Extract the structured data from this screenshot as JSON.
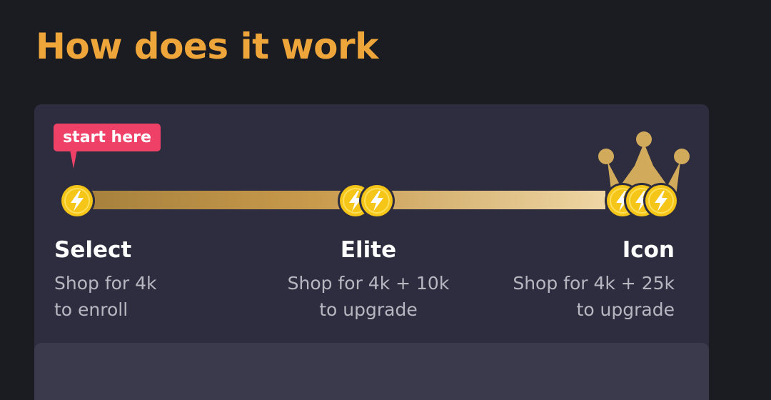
{
  "page": {
    "title": "How does it work",
    "title_color": "#eea53a"
  },
  "card": {
    "start_tag": "start here",
    "tiers": [
      {
        "name": "Select",
        "desc_line1": "Shop for 4k",
        "desc_line2": "to enroll",
        "coin_count": 1
      },
      {
        "name": "Elite",
        "desc_line1": "Shop for 4k + 10k",
        "desc_line2": "to upgrade",
        "coin_count": 2
      },
      {
        "name": "Icon",
        "desc_line1": "Shop for 4k + 25k",
        "desc_line2": "to upgrade",
        "coin_count": 3
      }
    ]
  },
  "icons": {
    "coin": "lightning-coin-icon",
    "crown": "crown-icon"
  },
  "colors": {
    "background": "#1b1b22",
    "card": "#2d2d3f",
    "tag": "#ef4167",
    "coin": "#f5c518",
    "crown": "#d1aa5c"
  }
}
